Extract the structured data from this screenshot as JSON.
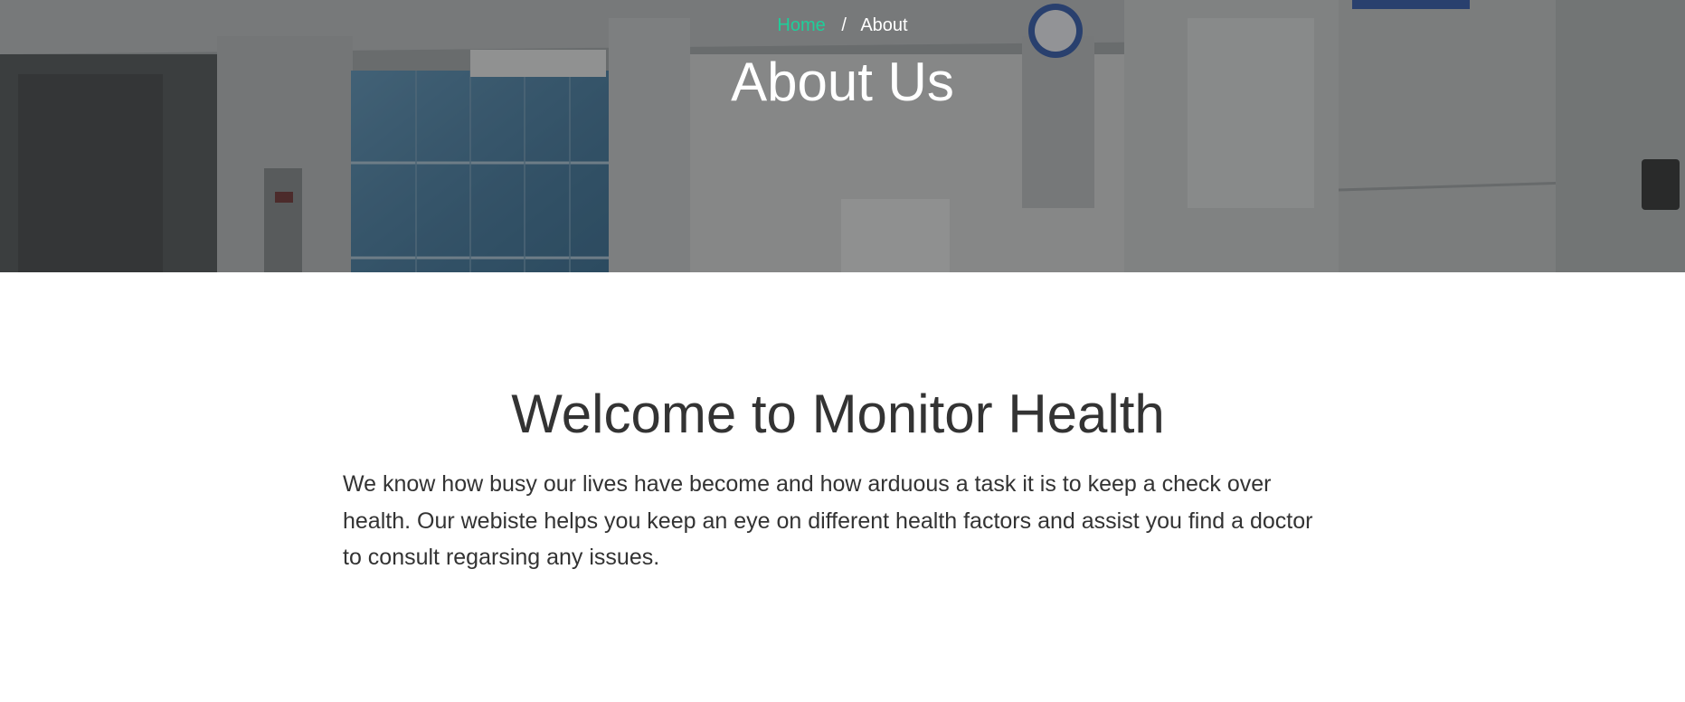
{
  "breadcrumb": {
    "home_label": "Home",
    "separator": "/",
    "current_label": "About"
  },
  "hero": {
    "title": "About Us"
  },
  "about": {
    "heading": "Welcome to Monitor Health",
    "body": "We know how busy our lives have become and how arduous a task it is to keep a check over health. Our webiste helps you keep an eye on different health factors and assist you find a doctor to consult regarsing any issues."
  },
  "colors": {
    "link_accent": "#1ecf9a",
    "text_dark": "#333333",
    "hero_text": "#ffffff"
  }
}
